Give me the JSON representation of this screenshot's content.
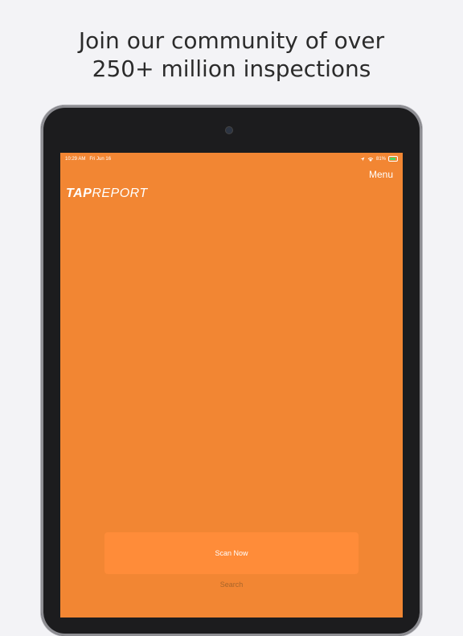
{
  "headline": {
    "line1": "Join our community of over",
    "line2": "250+ million inspections"
  },
  "statusbar": {
    "time": "10:29 AM",
    "date": "Fri Jun 16",
    "battery": "81%",
    "icons": [
      "location-icon",
      "wifi-icon",
      "battery-icon"
    ]
  },
  "app": {
    "menu_label": "Menu",
    "logo": {
      "part1": "TAP",
      "part2": "REPORT"
    },
    "scan_button_label": "Scan Now",
    "search_label": "Search"
  },
  "colors": {
    "background": "#f3f3f6",
    "screen": "#f28633",
    "scan_button": "#ff8c39",
    "device": "#1c1c1e"
  }
}
